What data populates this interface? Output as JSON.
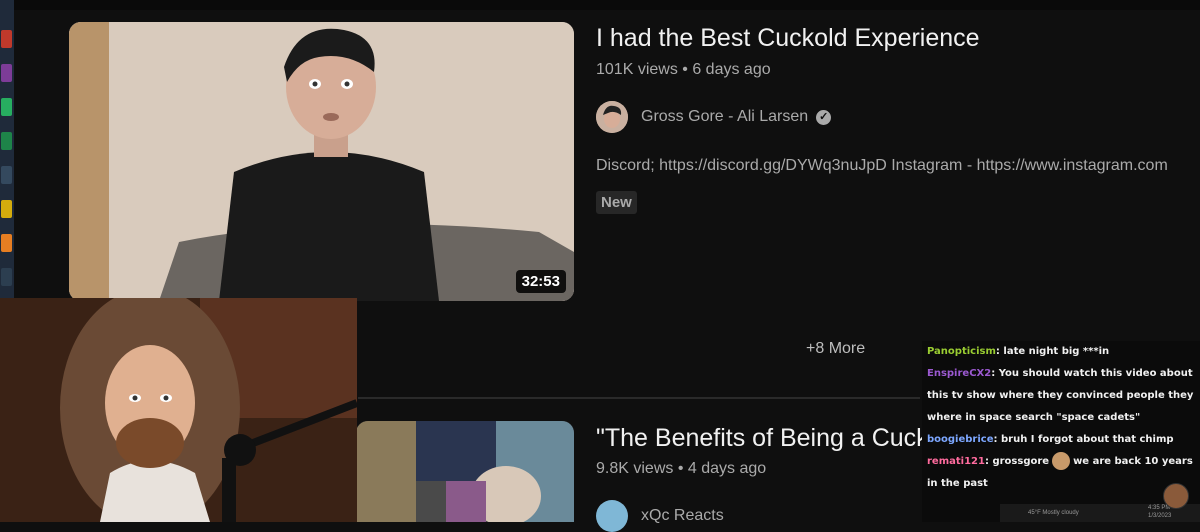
{
  "videos": [
    {
      "title": "I had the Best Cuckold Experience",
      "views": "101K views",
      "age": "6 days ago",
      "meta_separator": " • ",
      "channel": "Gross Gore - Ali Larsen",
      "verified": true,
      "description": "Discord; https://discord.gg/DYWq3nuJpD Instagram - https://www.instagram.com",
      "badge": "New",
      "duration": "32:53"
    },
    {
      "title": "\"The Benefits of Being a Cuck",
      "views": "9.8K views",
      "age": "4 days ago",
      "meta_separator": " • ",
      "channel": "xQc Reacts"
    }
  ],
  "more_button": "+8 More",
  "chat": {
    "messages": [
      {
        "user": "Panopticism",
        "text": "late night big ***in",
        "color": "#9acd32"
      },
      {
        "user": "EnspireCX2",
        "text": "You should watch this video about this tv show where they convinced people they where in space search \"space cadets\"",
        "color": "#9b59d0"
      },
      {
        "user": "boogiebrice",
        "text": "bruh I forgot about that chimp",
        "color": "#7da7ff"
      },
      {
        "user": "remati121",
        "text_before": "grossgore",
        "text_after": "we are back 10 years in the past",
        "color": "#ff6b9e",
        "emote": "face-emote"
      }
    ],
    "separator": ": "
  },
  "taskbar": {
    "weather": "45°F  Mostly cloudy",
    "time": "4:35 PM",
    "date": "1/3/2023"
  },
  "icons": [
    "verified-check-icon",
    "channel-avatar-icon",
    "face-emote"
  ]
}
